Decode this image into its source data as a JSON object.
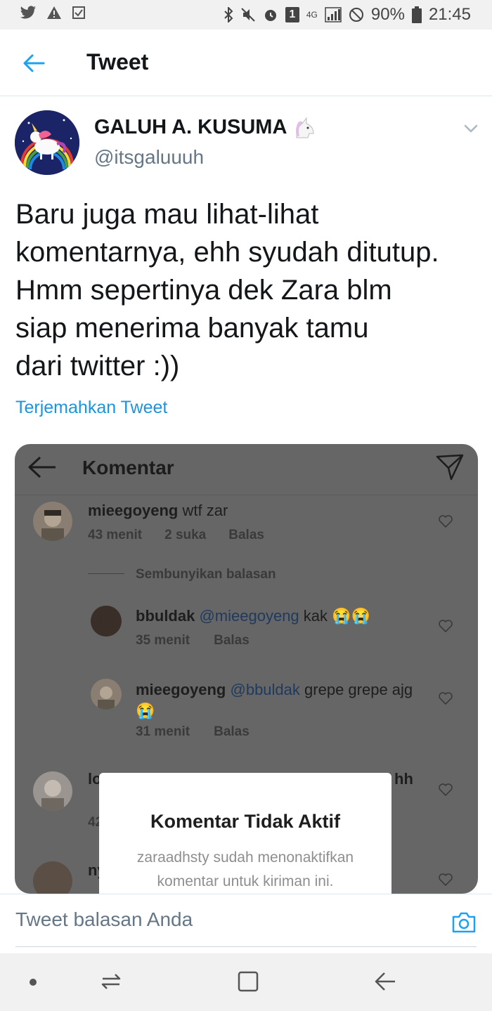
{
  "status_bar": {
    "battery_percent": "90%",
    "time": "21:45",
    "notification_count": "1",
    "network": "4G"
  },
  "header": {
    "title": "Tweet"
  },
  "tweet": {
    "author_name": "GALUH A. KUSUMA",
    "author_handle": "@itsgaluuuh",
    "text_lines": [
      "Baru juga mau lihat-lihat",
      "komentarnya, ehh syudah ditutup.",
      "Hmm sepertinya dek Zara blm",
      "siap menerima banyak tamu",
      "dari twitter :))"
    ],
    "translate_label": "Terjemahkan Tweet"
  },
  "image": {
    "header_title": "Komentar",
    "comments": [
      {
        "user": "mieegoyeng",
        "text": "wtf zar",
        "time": "43 menit",
        "likes": "2 suka",
        "reply": "Balas"
      },
      {
        "user": "bbuldak",
        "mention": "@mieegoyeng",
        "text": "kak 😭😭",
        "time": "35 menit",
        "reply": "Balas"
      },
      {
        "user": "mieegoyeng",
        "mention": "@bbuldak",
        "text": "grepe grepe ajg",
        "emoji": "😭",
        "time": "31 menit",
        "reply": "Balas"
      }
    ],
    "hide_replies": "Sembunyikan balasan",
    "partial": {
      "c4_user": "lo",
      "c4_tail": "hh",
      "c4_time": "42",
      "c5_user": "ny"
    },
    "dialog": {
      "title": "Komentar Tidak Aktif",
      "body_line1": "zaraadhsty sudah menonaktifkan",
      "body_line2": "komentar untuk kiriman ini."
    }
  },
  "reply_bar": {
    "placeholder": "Tweet balasan Anda"
  },
  "colors": {
    "link": "#1b95e0",
    "text_primary": "#14171a",
    "text_secondary": "#657786"
  }
}
